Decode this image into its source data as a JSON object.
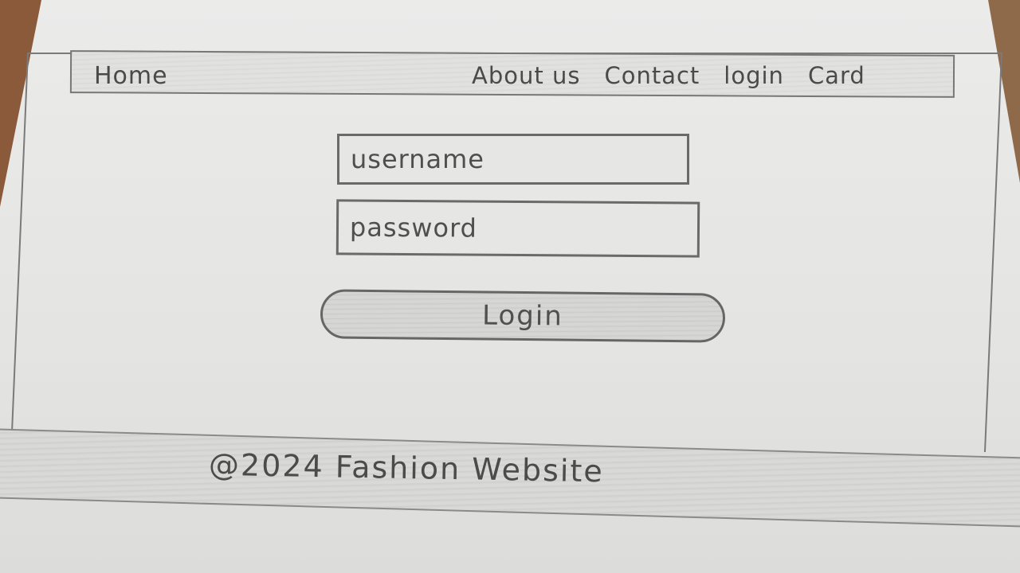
{
  "nav": {
    "home": "Home",
    "links": [
      "About us",
      "Contact",
      "login",
      "Card"
    ]
  },
  "form": {
    "username_placeholder": "username",
    "password_placeholder": "password",
    "login_label": "Login"
  },
  "footer": {
    "text": "@2024 Fashion Website"
  }
}
